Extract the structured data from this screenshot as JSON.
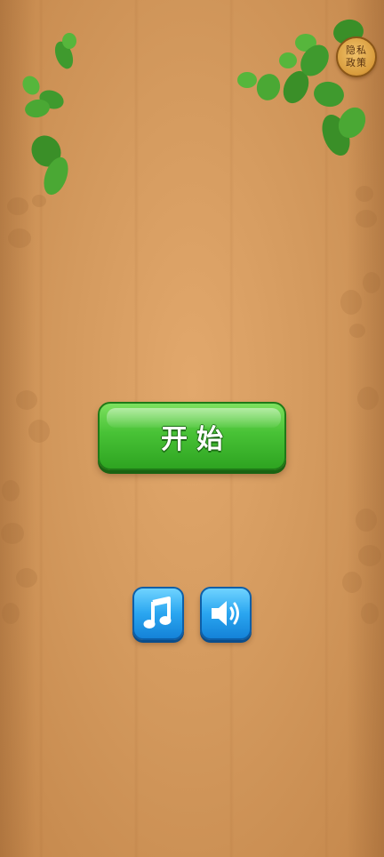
{
  "privacy": {
    "label": "隐私政策"
  },
  "start_button": {
    "label": "开始"
  },
  "controls": {
    "music_icon": "music-note-icon",
    "sound_icon": "speaker-icon"
  },
  "colors": {
    "wood_background": "#d49a5e",
    "start_button_green": "#48c236",
    "icon_button_blue": "#2aa6f0",
    "leaf_green": "#3f9a2e",
    "badge_gold": "#d89b3c"
  }
}
